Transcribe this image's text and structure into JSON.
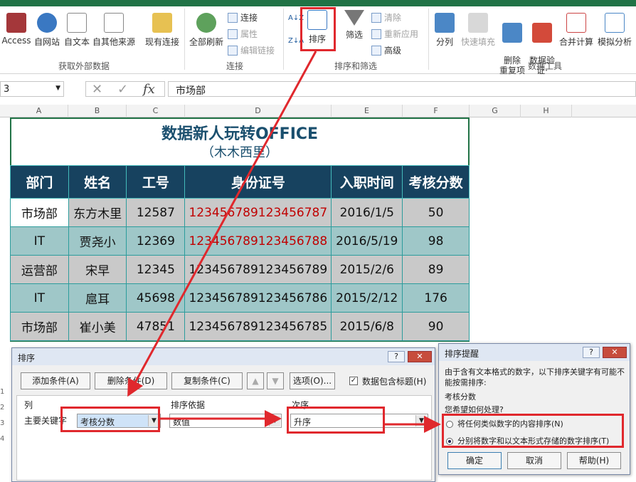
{
  "ribbon": {
    "get_external": {
      "access": "Access",
      "web": "自网站",
      "text": "自文本",
      "other": "自其他来源",
      "existing": "现有连接",
      "group": "获取外部数据"
    },
    "connections": {
      "refresh_all": "全部刷新",
      "connections": "连接",
      "properties": "属性",
      "edit_links": "编辑链接",
      "group": "连接"
    },
    "sort_filter": {
      "sort_az": "A↓Z",
      "sort_za": "Z↓A",
      "sort": "排序",
      "filter": "筛选",
      "clear": "清除",
      "reapply": "重新应用",
      "advanced": "高级",
      "group": "排序和筛选"
    },
    "data_tools": {
      "text_to_columns": "分列",
      "flash_fill": "快速填充",
      "remove_dup": "删除\n重复项",
      "validation": "数据验\n证·",
      "consolidate": "合并计算",
      "whatif": "模拟分析",
      "group": "数据工具"
    }
  },
  "formula_bar": {
    "name_box": "3",
    "fx": "fx",
    "content": "市场部"
  },
  "columns": [
    "A",
    "B",
    "C",
    "D",
    "E",
    "F",
    "G",
    "H"
  ],
  "sheet": {
    "title": "数据新人玩转OFFICE",
    "subtitle": "（木木西里）",
    "headers": [
      "部门",
      "姓名",
      "工号",
      "身份证号",
      "入职时间",
      "考核分数"
    ],
    "rows": [
      [
        "市场部",
        "东方木里",
        "12587",
        "123456789123456787",
        "2016/1/5",
        "50"
      ],
      [
        "IT",
        "贾尧小",
        "12369",
        "123456789123456788",
        "2016/5/19",
        "98"
      ],
      [
        "运营部",
        "宋早",
        "12345",
        "123456789123456789",
        "2015/2/6",
        "89"
      ],
      [
        "IT",
        "扈耳",
        "45698",
        "123456789123456786",
        "2015/2/12",
        "176"
      ],
      [
        "市场部",
        "崔小美",
        "47851",
        "123456789123456785",
        "2015/6/8",
        "90"
      ]
    ]
  },
  "sort_dialog": {
    "title": "排序",
    "help": "?",
    "close": "✕",
    "add_level": "添加条件(A)",
    "delete_level": "删除条件(D)",
    "copy_level": "复制条件(C)",
    "up": "▲",
    "down": "▼",
    "options": "选项(O)...",
    "has_headers": "数据包含标题(H)",
    "col_header": "列",
    "sorton_header": "排序依据",
    "order_header": "次序",
    "main_key": "主要关键字",
    "key_value": "考核分数",
    "sort_on_value": "数值",
    "order_value": "升序"
  },
  "warning_dialog": {
    "title": "排序提醒",
    "help": "?",
    "close": "✕",
    "message": "由于含有文本格式的数字，以下排序关键字有可能不能按需排序:",
    "key": "考核分数",
    "question": "您希望如何处理?",
    "option1": "将任何类似数字的内容排序(N)",
    "option2": "分别将数字和以文本形式存储的数字排序(T)",
    "ok": "确定",
    "cancel": "取消",
    "help_btn": "帮助(H)"
  },
  "row_numbers": [
    "1",
    "2",
    "3",
    "4"
  ]
}
